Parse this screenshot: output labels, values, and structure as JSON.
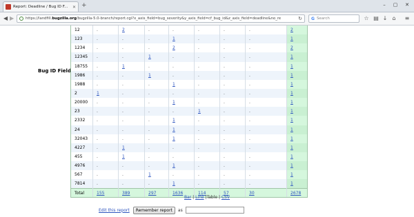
{
  "browser": {
    "tab_title": "Report: Deadline / Bug ID F...",
    "new_tab": "+",
    "url_prefix": "https://landfill.",
    "url_domain": "bugzilla.org",
    "url_rest": "/bugzilla-5.0-branch/report.cgi?x_axis_field=bug_severity&y_axis_field=cf_bug_id&z_axis_field=deadline&no_re",
    "search_placeholder": "Search",
    "window_controls": [
      "–",
      "▢",
      "✕"
    ]
  },
  "report": {
    "row_axis_label": "Bug ID Field",
    "rows": [
      {
        "id": "12",
        "cells": [
          ".",
          "2",
          ".",
          ".",
          ".",
          ".",
          "."
        ],
        "total": "2"
      },
      {
        "id": "123",
        "cells": [
          ".",
          ".",
          ".",
          "1",
          ".",
          ".",
          "."
        ],
        "total": "1"
      },
      {
        "id": "1234",
        "cells": [
          ".",
          ".",
          ".",
          "2",
          ".",
          ".",
          "."
        ],
        "total": "2"
      },
      {
        "id": "12345",
        "cells": [
          ".",
          ".",
          "1",
          ".",
          ".",
          ".",
          "."
        ],
        "total": "1"
      },
      {
        "id": "18755",
        "cells": [
          ".",
          "1",
          ".",
          ".",
          ".",
          ".",
          "."
        ],
        "total": "1"
      },
      {
        "id": "1986",
        "cells": [
          ".",
          ".",
          "1",
          ".",
          ".",
          ".",
          "."
        ],
        "total": "1"
      },
      {
        "id": "1988",
        "cells": [
          ".",
          ".",
          ".",
          "1",
          ".",
          ".",
          "."
        ],
        "total": "1"
      },
      {
        "id": "2",
        "cells": [
          "1",
          ".",
          ".",
          ".",
          ".",
          ".",
          "."
        ],
        "total": "1"
      },
      {
        "id": "20000",
        "cells": [
          ".",
          ".",
          ".",
          "1",
          ".",
          ".",
          "."
        ],
        "total": "1"
      },
      {
        "id": "23",
        "cells": [
          ".",
          ".",
          ".",
          ".",
          "1",
          ".",
          "."
        ],
        "total": "1"
      },
      {
        "id": "2332",
        "cells": [
          ".",
          ".",
          ".",
          "1",
          ".",
          ".",
          "."
        ],
        "total": "1"
      },
      {
        "id": "24",
        "cells": [
          ".",
          ".",
          ".",
          "1",
          ".",
          ".",
          "."
        ],
        "total": "1"
      },
      {
        "id": "32043",
        "cells": [
          ".",
          ".",
          ".",
          "1",
          ".",
          ".",
          "."
        ],
        "total": "1"
      },
      {
        "id": "4227",
        "cells": [
          ".",
          "1",
          ".",
          ".",
          ".",
          ".",
          "."
        ],
        "total": "1"
      },
      {
        "id": "455",
        "cells": [
          ".",
          "1",
          ".",
          ".",
          ".",
          ".",
          "."
        ],
        "total": "1"
      },
      {
        "id": "4976",
        "cells": [
          ".",
          ".",
          ".",
          "1",
          ".",
          ".",
          "."
        ],
        "total": "1"
      },
      {
        "id": "567",
        "cells": [
          ".",
          ".",
          "1",
          ".",
          ".",
          ".",
          "."
        ],
        "total": "1"
      },
      {
        "id": "7814",
        "cells": [
          ".",
          ".",
          ".",
          "1",
          ".",
          ".",
          "."
        ],
        "total": "1"
      }
    ],
    "total_row": {
      "label": "Total",
      "cells": [
        "155",
        "389",
        "297",
        "1636",
        "114",
        "57",
        "30"
      ],
      "grand_total": "2678"
    }
  },
  "formats": {
    "bar": "Bar",
    "line": "Line",
    "table": "Table",
    "csv": "CSV",
    "separator": "|"
  },
  "actions": {
    "edit_link": "Edit this report",
    "remember_button": "Remember report",
    "as_label": "as"
  },
  "colors": {
    "link": "#2a52be",
    "total_column": "#d5f7dd",
    "alt_row": "#eef4fb"
  }
}
